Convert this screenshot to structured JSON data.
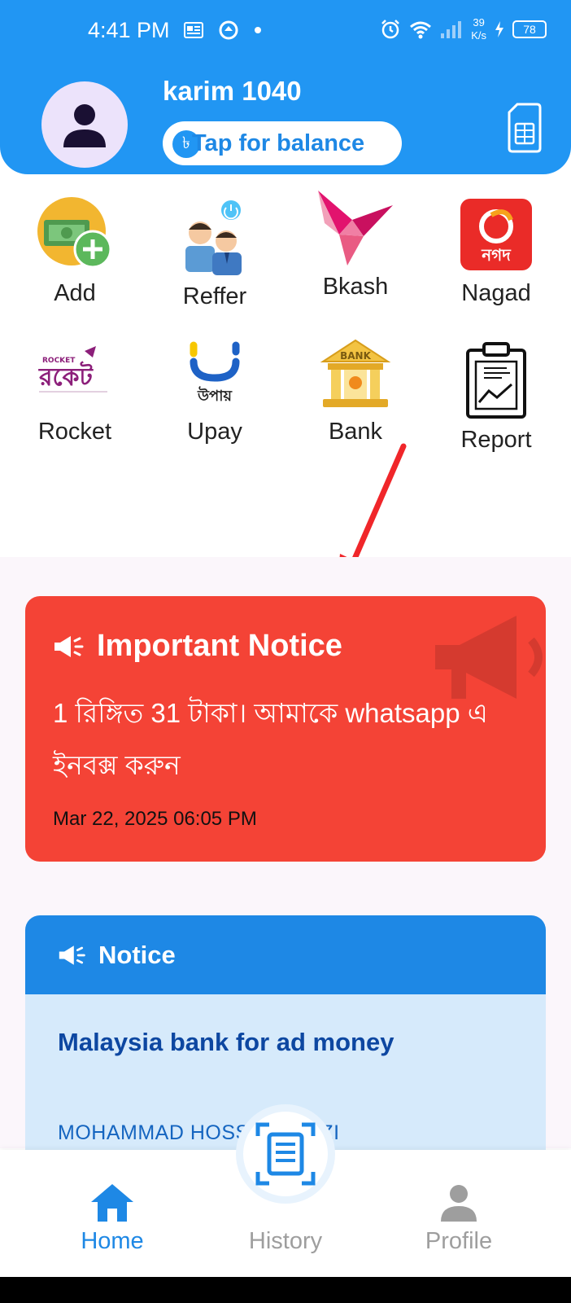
{
  "status_bar": {
    "time": "4:41 PM",
    "net_speed_value": "39",
    "net_speed_unit": "K/s",
    "battery": "78"
  },
  "header": {
    "user_name": "karim 1040",
    "balance_label": "Tap for balance",
    "taka_symbol": "৳"
  },
  "services": [
    {
      "label": "Add"
    },
    {
      "label": "Reffer"
    },
    {
      "label": "Bkash"
    },
    {
      "label": "Nagad"
    },
    {
      "label": "Rocket"
    },
    {
      "label": "Upay"
    },
    {
      "label": "Bank"
    },
    {
      "label": "Report"
    }
  ],
  "logos": {
    "nagad_text": "নগদ",
    "rocket_small": "ROCKET",
    "rocket_text": "রকেট",
    "upay_text": "উপায়",
    "bank_text": "BANK"
  },
  "important_notice": {
    "title": "Important Notice",
    "message": "1 রিঙ্গিত 31 টাকা। আমাকে whatsapp এ ইনবক্স করুন",
    "date": "Mar 22, 2025 06:05 PM"
  },
  "notice": {
    "title": "Notice",
    "body_title": "Malaysia bank  for ad money",
    "body_line": "MOHAMMAD HOSSAIN GAZI"
  },
  "bottom_nav": {
    "home": "Home",
    "history": "History",
    "profile": "Profile"
  },
  "colors": {
    "primary": "#2196f3",
    "notice_red": "#f44336",
    "notice_blue": "#1e88e5",
    "nav_active": "#1e88e5",
    "nav_inactive": "#9e9e9e"
  }
}
